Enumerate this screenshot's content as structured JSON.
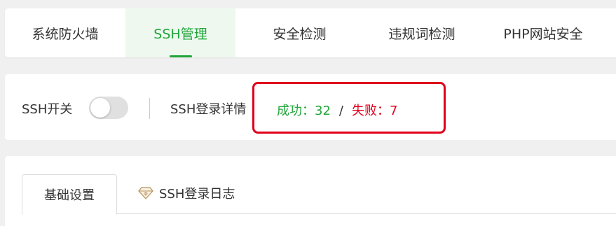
{
  "top_tabs": [
    {
      "label": "系统防火墙",
      "active": false
    },
    {
      "label": "SSH管理",
      "active": true
    },
    {
      "label": "安全检测",
      "active": false
    },
    {
      "label": "违规词检测",
      "active": false
    },
    {
      "label": "PHP网站安全",
      "active": false
    }
  ],
  "ssh_bar": {
    "switch_label": "SSH开关",
    "switch_state": "off",
    "login_detail_label": "SSH登录详情",
    "success_text": "成功：32",
    "separator": "/",
    "fail_text": "失败：7"
  },
  "colors": {
    "accent": "#20a53a",
    "danger": "#e0001b",
    "highlight_border": "#e0001b"
  },
  "sub_tabs": [
    {
      "label": "基础设置",
      "active": true
    },
    {
      "label": "SSH登录日志",
      "active": false,
      "icon": "enterprise-diamond-icon"
    }
  ]
}
